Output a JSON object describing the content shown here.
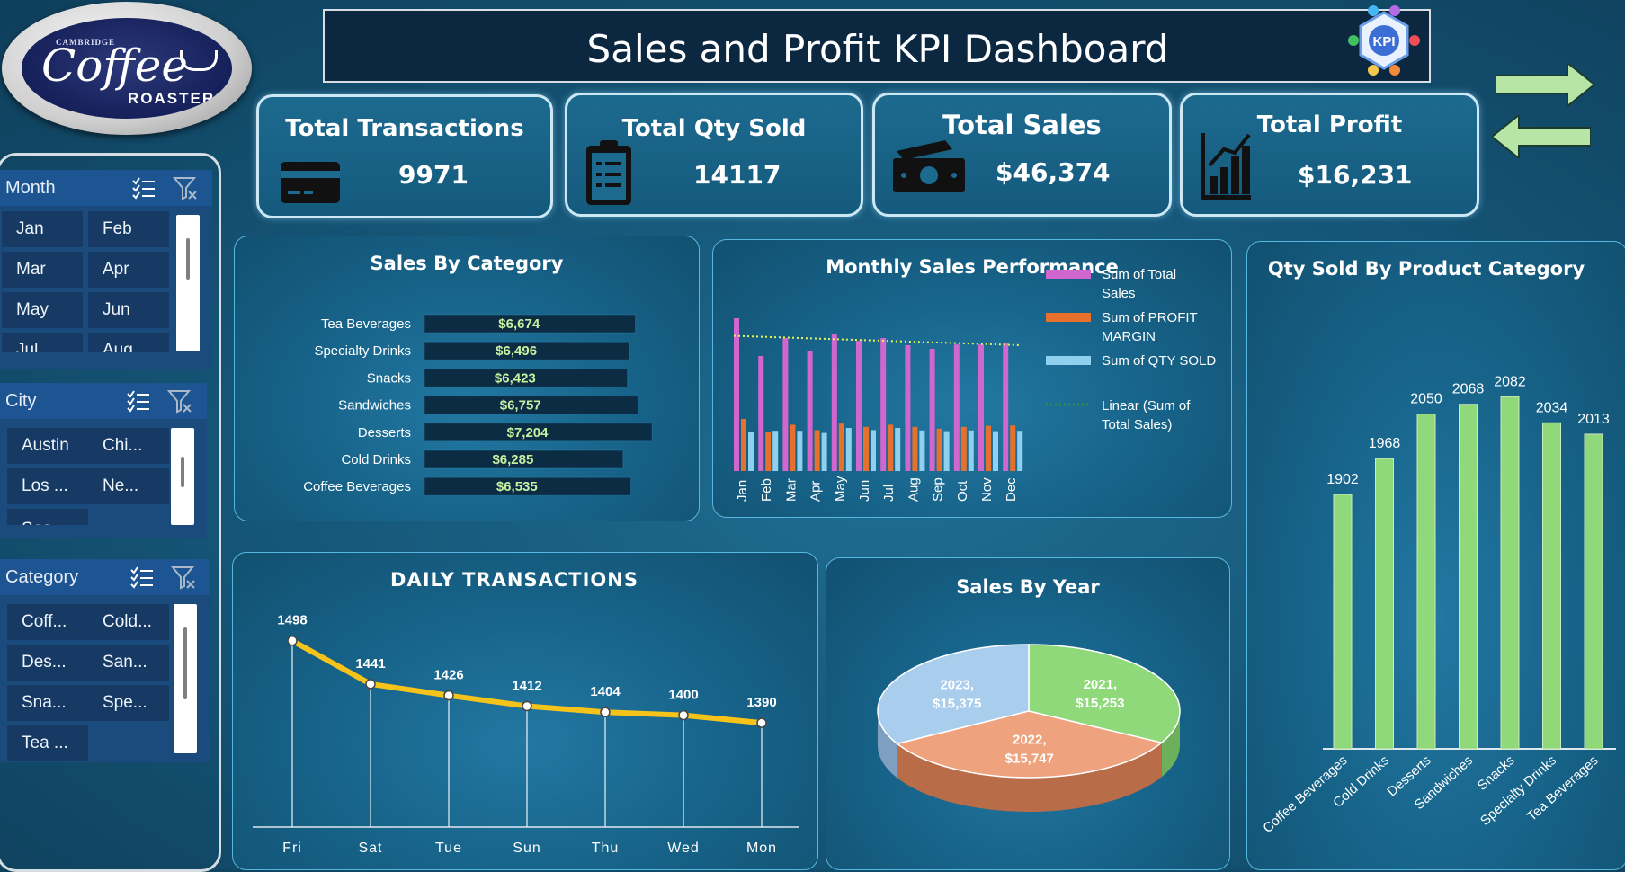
{
  "logo": {
    "small": "CAMBRIDGE",
    "big": "Coffee",
    "sub": "ROASTERS"
  },
  "header": {
    "title": "Sales and Profit KPI Dashboard",
    "kpi_badge": "KPI"
  },
  "kpis": [
    {
      "label": "Total Transactions",
      "value": "9971",
      "icon": "credit-card-icon"
    },
    {
      "label": "Total Qty Sold",
      "value": "14117",
      "icon": "clipboard-icon"
    },
    {
      "label": "Total Sales",
      "value": "$46,374",
      "icon": "cash-icon"
    },
    {
      "label": "Total Profit",
      "value": "$16,231",
      "icon": "bar-growth-icon"
    }
  ],
  "slicers": {
    "month": {
      "label": "Month",
      "items": [
        "Jan",
        "Feb",
        "Mar",
        "Apr",
        "May",
        "Jun",
        "Jul",
        "Aug"
      ]
    },
    "city": {
      "label": "City",
      "items": [
        "Austin",
        "Chi...",
        "Los ...",
        "Ne...",
        "Sea..."
      ]
    },
    "category": {
      "label": "Category",
      "items": [
        "Coff...",
        "Cold...",
        "Des...",
        "San...",
        "Sna...",
        "Spe...",
        "Tea ..."
      ]
    }
  },
  "colors": {
    "pink": "#d266cf",
    "orange": "#e8702d",
    "lightblue": "#8fd0ee",
    "green": "#8fd97a",
    "yellow": "#f6c31a",
    "trend": "#e7f55a"
  },
  "chart_data": [
    {
      "type": "bar",
      "title": "Sales  By Category",
      "orientation": "horizontal",
      "categories": [
        "Tea Beverages",
        "Specialty Drinks",
        "Snacks",
        "Sandwiches",
        "Desserts",
        "Cold Drinks",
        "Coffee Beverages"
      ],
      "values": [
        6674,
        6496,
        6423,
        6757,
        7204,
        6285,
        6535
      ],
      "labels": [
        "$6,674",
        "$6,496",
        "$6,423",
        "$6,757",
        "$7,204",
        "$6,285",
        "$6,535"
      ]
    },
    {
      "type": "bar",
      "title": "Monthly Sales Performance",
      "categories": [
        "Jan",
        "Feb",
        "Mar",
        "Apr",
        "May",
        "Jun",
        "Jul",
        "Aug",
        "Sep",
        "Oct",
        "Nov",
        "Dec"
      ],
      "series": [
        {
          "name": "Sum of Total Sales",
          "values": [
            4250,
            3200,
            3700,
            3350,
            3800,
            3620,
            3700,
            3500,
            3400,
            3520,
            3520,
            3560
          ]
        },
        {
          "name": "Sum of PROFIT MARGIN",
          "values": [
            1450,
            1080,
            1290,
            1140,
            1320,
            1230,
            1290,
            1230,
            1180,
            1230,
            1260,
            1270
          ]
        },
        {
          "name": "Sum of QTY SOLD",
          "values": [
            1080,
            1120,
            1120,
            1060,
            1200,
            1140,
            1200,
            1130,
            1110,
            1130,
            1110,
            1120
          ]
        }
      ],
      "trendline": {
        "name": "Linear (Sum of Total Sales)",
        "start": 3760,
        "end": 3500
      },
      "legend": "right"
    },
    {
      "type": "bar",
      "title": "Qty Sold By Product Category",
      "categories": [
        "Coffee Beverages",
        "Cold Drinks",
        "Desserts",
        "Sandwiches",
        "Snacks",
        "Specialty Drinks",
        "Tea Beverages"
      ],
      "values": [
        1902,
        1968,
        2050,
        2068,
        2082,
        2034,
        2013
      ]
    },
    {
      "type": "line",
      "title": "DAILY TRANSACTIONS",
      "categories": [
        "Fri",
        "Sat",
        "Tue",
        "Sun",
        "Thu",
        "Wed",
        "Mon"
      ],
      "values": [
        1498,
        1441,
        1426,
        1412,
        1404,
        1400,
        1390
      ]
    },
    {
      "type": "pie",
      "title": "Sales By Year",
      "slices": [
        {
          "label": "2021,",
          "value": 15253,
          "text": "$15,253"
        },
        {
          "label": "2022,",
          "value": 15747,
          "text": "$15,747"
        },
        {
          "label": "2023,",
          "value": 15375,
          "text": "$15,375"
        }
      ]
    }
  ]
}
